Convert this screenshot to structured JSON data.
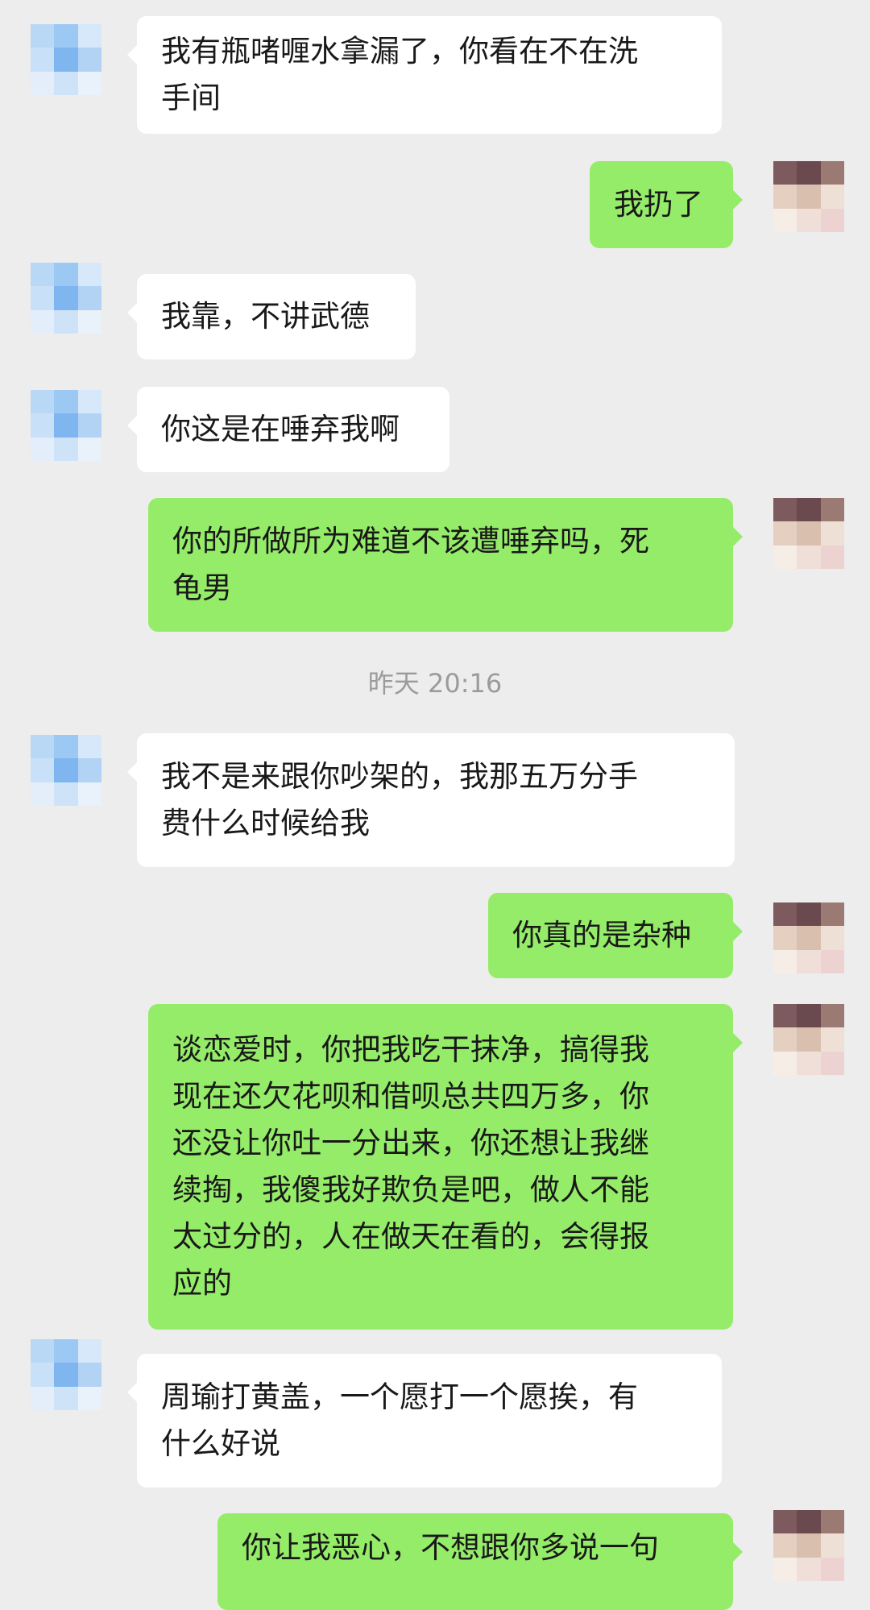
{
  "chat": {
    "timestamp": "昨天 20:16",
    "messages": [
      {
        "side": "received",
        "text": "我有瓶啫喱水拿漏了，你看在不在洗\n手间"
      },
      {
        "side": "sent",
        "text": "我扔了"
      },
      {
        "side": "received",
        "text": "我靠，不讲武德"
      },
      {
        "side": "received",
        "text": "你这是在唾弃我啊"
      },
      {
        "side": "sent",
        "text": "你的所做所为难道不该遭唾弃吗，死\n龟男"
      },
      {
        "side": "received",
        "text": "我不是来跟你吵架的，我那五万分手\n费什么时候给我"
      },
      {
        "side": "sent",
        "text": "你真的是杂种"
      },
      {
        "side": "sent",
        "text": "谈恋爱时，你把我吃干抹净，搞得我\n现在还欠花呗和借呗总共四万多，你\n还没让你吐一分出来，你还想让我继\n续掏，我傻我好欺负是吧，做人不能\n太过分的，人在做天在看的，会得报\n应的"
      },
      {
        "side": "received",
        "text": "周瑜打黄盖，一个愿打一个愿挨，有\n什么好说"
      },
      {
        "side": "sent",
        "text": "你让我恶心，不想跟你多说一句"
      }
    ]
  },
  "colors": {
    "background": "#ededed",
    "received_bubble": "#ffffff",
    "sent_bubble": "#95ec69",
    "text": "#191919",
    "timestamp": "#9b9b9b"
  }
}
